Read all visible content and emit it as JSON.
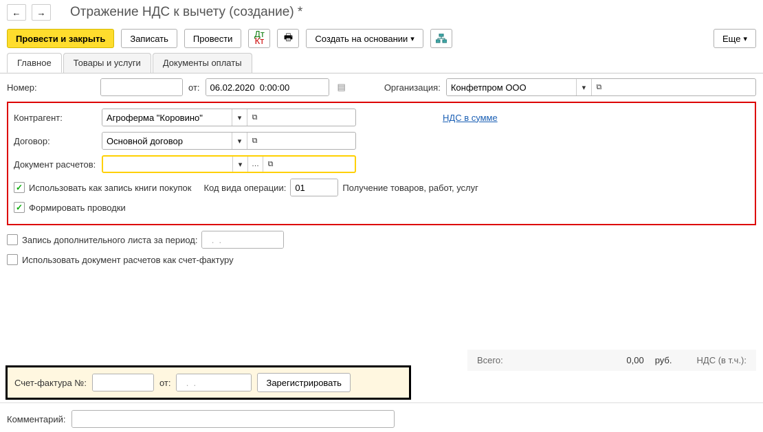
{
  "header": {
    "title": "Отражение НДС к вычету (создание) *"
  },
  "toolbar": {
    "post_and_close": "Провести и закрыть",
    "write": "Записать",
    "post": "Провести",
    "create_based": "Создать на основании",
    "more": "Еще"
  },
  "tabs": {
    "main": "Главное",
    "goods": "Товары и услуги",
    "paydocs": "Документы оплаты"
  },
  "fields": {
    "number_label": "Номер:",
    "from_label": "от:",
    "date": "06.02.2020  0:00:00",
    "org_label": "Организация:",
    "org_value": "Конфетпром ООО",
    "contractor_label": "Контрагент:",
    "contractor_value": "Агроферма \"Коровино\"",
    "vat_in_sum": "НДС в сумме",
    "contract_label": "Договор:",
    "contract_value": "Основной договор",
    "calc_doc_label": "Документ расчетов:",
    "calc_doc_value": "",
    "use_as_purchase": "Использовать как запись книги покупок",
    "oper_code_label": "Код вида операции:",
    "oper_code": "01",
    "oper_desc": "Получение товаров, работ, услуг",
    "form_entries": "Формировать проводки",
    "add_sheet": "Запись дополнительного листа за период:",
    "add_sheet_date": "  .  .    ",
    "use_calc_as_invoice": "Использовать документ расчетов как счет-фактуру",
    "invoice_num_label": "Счет-фактура №:",
    "invoice_from": "от:",
    "invoice_date": "  .  .    ",
    "register": "Зарегистрировать",
    "total_label": "Всего:",
    "total_value": "0,00",
    "currency": "руб.",
    "vat_incl": "НДС (в т.ч.):",
    "comment_label": "Комментарий:"
  }
}
